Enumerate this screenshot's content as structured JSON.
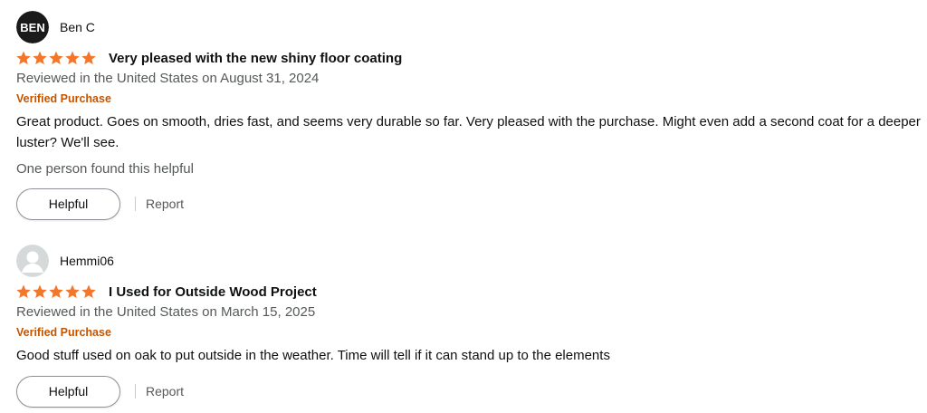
{
  "reviews": [
    {
      "reviewer": "Ben C",
      "avatar_icon": "ben-logo-avatar",
      "avatar_text": "BEN",
      "rating": 5,
      "title": "Very pleased with the new shiny floor coating",
      "date": "Reviewed in the United States on August 31, 2024",
      "verified": "Verified Purchase",
      "body": "Great product. Goes on smooth, dries fast, and seems very durable so far. Very pleased with the purchase. Might even add a second coat for a deeper luster? We'll see.",
      "helpful_count": "One person found this helpful",
      "helpful_label": "Helpful",
      "report_label": "Report"
    },
    {
      "reviewer": "Hemmi06",
      "avatar_icon": "default-user-avatar",
      "rating": 5,
      "title": "I Used for Outside Wood Project",
      "date": "Reviewed in the United States on March 15, 2025",
      "verified": "Verified Purchase",
      "body": "Good stuff used on oak to put outside in the weather. Time will tell if it can stand up to the elements",
      "helpful_label": "Helpful",
      "report_label": "Report"
    }
  ],
  "colors": {
    "star": "#f3772a",
    "verified": "#c45500",
    "muted_text": "#565959"
  }
}
